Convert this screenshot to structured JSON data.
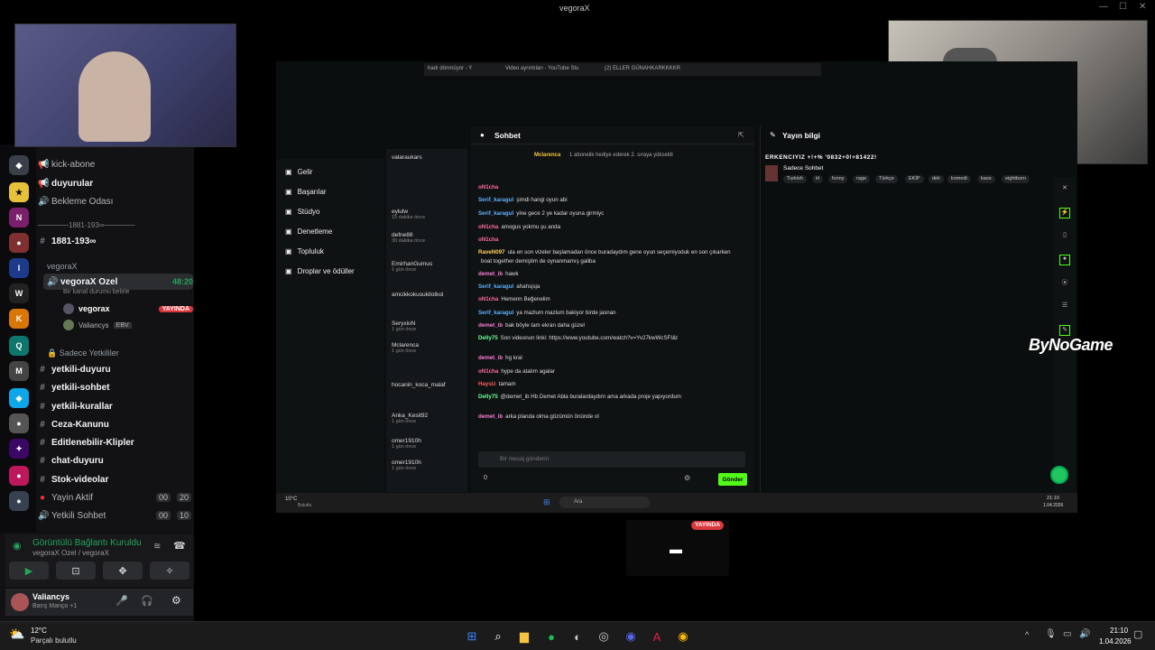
{
  "window": {
    "title": "vegoraX"
  },
  "discord": {
    "channels": [
      {
        "label": "kick-abone",
        "muted": true
      },
      {
        "label": "duyurular"
      },
      {
        "label": "Bekleme Odası"
      },
      {
        "label": "──────1881-193∞──────"
      },
      {
        "label": "1881-193∞"
      }
    ],
    "category_vegorax": "vegoraX",
    "voice_channel": {
      "label": "vegoraX Ozel",
      "timer": "48:20",
      "status_hint": "Bir kanal durumu belirle"
    },
    "voice_users": [
      {
        "name": "vegorax",
        "badge": "YAYINDA"
      },
      {
        "name": "Valiancys",
        "tag": "EBV"
      }
    ],
    "category_admins": "Sadece Yetkililer",
    "admin_channels": [
      {
        "label": "yetkili-duyuru"
      },
      {
        "label": "yetkili-sohbet"
      },
      {
        "label": "yetkili-kurallar"
      },
      {
        "label": "Ceza-Kanunu"
      },
      {
        "label": "Editlenebilir-Klipler"
      },
      {
        "label": "chat-duyuru"
      },
      {
        "label": "Stok-videolar"
      },
      {
        "label": "Yayin Aktif",
        "c1": "00",
        "c2": "20"
      },
      {
        "label": "Yetkili Sohbet",
        "c1": "00",
        "c2": "10"
      }
    ],
    "voice_panel": {
      "status": "Görüntülü Bağlantı Kuruldu",
      "sub": "vegoraX Ozel / vegoraX"
    },
    "user_panel": {
      "name": "Valiancys",
      "activity": "Barış Manço +1"
    }
  },
  "kick": {
    "tabs": [
      "hadı dönmüyor - Y",
      "Video ayrıntıları - YouTube Stu",
      "(2) ELLER GÜNAHKARKKKKR"
    ],
    "nav": [
      "Gelir",
      "Başarılar",
      "Stüdyo",
      "Denetleme",
      "Topluluk",
      "Droplar ve ödüller"
    ],
    "following": [
      {
        "name": "valaraukars",
        "time": ""
      },
      {
        "name": "eylulw",
        "time": "15 dakika önce"
      },
      {
        "name": "defne88",
        "time": "30 dakika önce"
      },
      {
        "name": "EmirhanGumus",
        "time": "1 gün önce"
      },
      {
        "name": "amcikkokusukilotkol",
        "time": ""
      },
      {
        "name": "SeryxioN",
        "time": "1 gün önce"
      },
      {
        "name": "Mclarenca",
        "time": "1 gün önce"
      },
      {
        "name": "hocanin_koca_malaf",
        "time": ""
      },
      {
        "name": "Anka_Kesit92",
        "time": "1 gün önce"
      },
      {
        "name": "omer1910h",
        "time": "1 gün önce"
      },
      {
        "name": "omer1910h",
        "time": "1 gün önce"
      }
    ],
    "chat_title": "Sohbet",
    "pinned": {
      "user": "Mclarenca",
      "text": "1 abonelik hediye ederek 2. sıraya yükseldi"
    },
    "messages": [
      {
        "user": "oN1cha",
        "text": "",
        "color": "#ff6aa0"
      },
      {
        "user": "Serif_karagul",
        "text": "şimdi hangi oyun abi",
        "color": "#62b1ff"
      },
      {
        "user": "Serif_karagul",
        "text": "yine gece 2 ye kadar oyuna girmiyc",
        "color": "#62b1ff"
      },
      {
        "user": "oN1cha",
        "text": "amogus yokmu şu anda",
        "color": "#ff6aa0"
      },
      {
        "user": "oN1cha",
        "text": "",
        "color": "#ff6aa0"
      },
      {
        "user": "RaveN097",
        "text": "ula en son vizeler başlamadan önce buradaydım gene oyun seçemiyoduk en son çıkarken",
        "color": "#ffd05b"
      },
      {
        "user": "",
        "text": "boat together demiştim de oynanmamış galiba",
        "color": "#ddd"
      },
      {
        "user": "demet_ib",
        "text": "hawk",
        "color": "#ff7bd9"
      },
      {
        "user": "Serif_karagul",
        "text": "ahahsjsja",
        "color": "#62b1ff"
      },
      {
        "user": "oN1cha",
        "text": "Hemenn Beğenelim",
        "color": "#ff6aa0"
      },
      {
        "user": "Serif_karagul",
        "text": "ya mazlum mazlum bakiyor birde jasnan",
        "color": "#62b1ff"
      },
      {
        "user": "demet_ib",
        "text": "bak böyle tam ekran daha güzel",
        "color": "#ff7bd9"
      },
      {
        "user": "Delly75",
        "text": "Son videonun linki: https://www.youtube.com/watch?v=Yv27kwWcSFI&t",
        "color": "#6aff9a"
      },
      {
        "user": "demet_ib",
        "text": "hg kral",
        "color": "#ff7bd9"
      },
      {
        "user": "oN1cha",
        "text": "hype da atalım agalar",
        "color": "#ff6aa0"
      },
      {
        "user": "Haysiz",
        "text": "tamam",
        "color": "#ff5c5c"
      },
      {
        "user": "Delly75",
        "text": "@demet_ib Hb Demet Abla buralardaydım ama arkada proje yapıyordum",
        "color": "#6aff9a"
      },
      {
        "user": "demet_ib",
        "text": "arka planda olma gözümün önünde ol",
        "color": "#ff7bd9"
      }
    ],
    "chat_placeholder": "Bir mesaj gönderin",
    "send_label": "Gönder",
    "stream_title": "ERKENCIYIZ +!+% '0832+0!+81422!",
    "right_header": "Yayın bilgi",
    "category": "Sadece Sohbet",
    "tags": [
      "Turkish",
      "irl",
      "funny",
      "rage",
      "Türkçe",
      "EKİP",
      "deli",
      "komedi",
      "kaos",
      "eightborn"
    ],
    "inner_search": "Ara",
    "inner_weather": "10°C",
    "inner_weather_sub": "Bulutlu",
    "inner_time": "21:10",
    "inner_date": "1.04.2026",
    "bottom_count": "0"
  },
  "brand_overlay": "ByNoGame",
  "live_badge": "YAYINDA",
  "taskbar": {
    "weather_temp": "12°C",
    "weather_desc": "Parçalı bulutlu",
    "time": "21:10",
    "date": "1.04.2026"
  }
}
